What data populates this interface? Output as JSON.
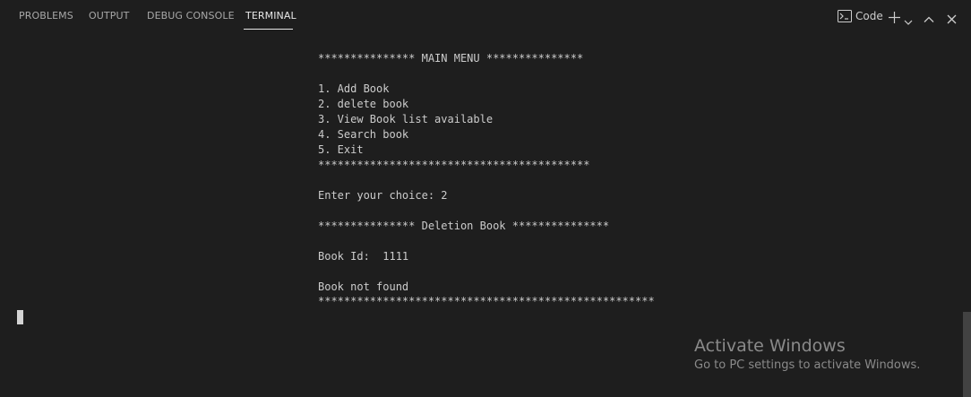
{
  "tabs": [
    {
      "label": "PROBLEMS"
    },
    {
      "label": "OUTPUT"
    },
    {
      "label": "DEBUG CONSOLE"
    },
    {
      "label": "TERMINAL",
      "active": true
    }
  ],
  "actions": {
    "terminal_label": "Code",
    "icons": [
      "terminal-icon",
      "plus-icon",
      "chevron-down-icon",
      "chevron-up-icon",
      "close-icon"
    ]
  },
  "terminal": {
    "lines": [
      "*************** MAIN MENU ***************",
      "",
      "1. Add Book",
      "2. delete book",
      "3. View Book list available",
      "4. Search book",
      "5. Exit",
      "******************************************",
      "",
      "Enter your choice: 2",
      "",
      "*************** Deletion Book ***************",
      "",
      "Book Id:  1111",
      "",
      "Book not found",
      "****************************************************"
    ]
  },
  "watermark": {
    "title": "Activate Windows",
    "subtitle": "Go to PC settings to activate Windows."
  },
  "colors": {
    "background": "#1e1e1e",
    "text": "#cccccc",
    "tab_inactive": "#a8a8a8",
    "tab_active": "#e7e7e7"
  }
}
